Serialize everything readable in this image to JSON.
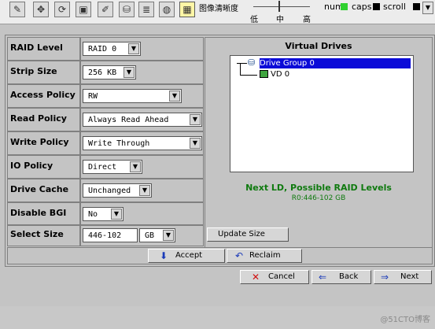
{
  "toolbar": {
    "quality_label": "图像清晰度",
    "quality_low": "低",
    "quality_mid": "中",
    "quality_high": "高",
    "num_label": "num",
    "caps_label": "caps",
    "scroll_label": "scroll",
    "num_led_color": "#2fd12f",
    "caps_led_color": "#000000",
    "scroll_led_color": "#000000",
    "icons": [
      "pin-icon",
      "move-icon",
      "refresh-icon",
      "window-icon",
      "disk-icon",
      "stack-icon",
      "globe-icon",
      "image-quality-icon"
    ]
  },
  "form": {
    "raid_level": {
      "label": "RAID Level",
      "value": "RAID 0"
    },
    "strip_size": {
      "label": "Strip Size",
      "value": "256 KB"
    },
    "access_policy": {
      "label": "Access Policy",
      "value": "RW"
    },
    "read_policy": {
      "label": "Read Policy",
      "value": "Always Read Ahead"
    },
    "write_policy": {
      "label": "Write Policy",
      "value": "Write Through"
    },
    "io_policy": {
      "label": "IO Policy",
      "value": "Direct"
    },
    "drive_cache": {
      "label": "Drive Cache",
      "value": "Unchanged"
    },
    "disable_bgi": {
      "label": "Disable BGI",
      "value": "No"
    },
    "select_size": {
      "label": "Select Size",
      "value": "446-102",
      "unit": "GB"
    }
  },
  "virtual_drives": {
    "title": "Virtual Drives",
    "tree": [
      {
        "label": "Drive Group 0",
        "selected": true
      },
      {
        "label": "VD 0",
        "selected": false
      }
    ],
    "next_ld": "Next LD, Possible RAID Levels",
    "next_ld_size": "R0:446-102 GB"
  },
  "buttons": {
    "update_size": "Update Size",
    "accept": "Accept",
    "reclaim": "Reclaim",
    "cancel": "Cancel",
    "back": "Back",
    "next": "Next"
  },
  "watermark": "@51CTO博客"
}
